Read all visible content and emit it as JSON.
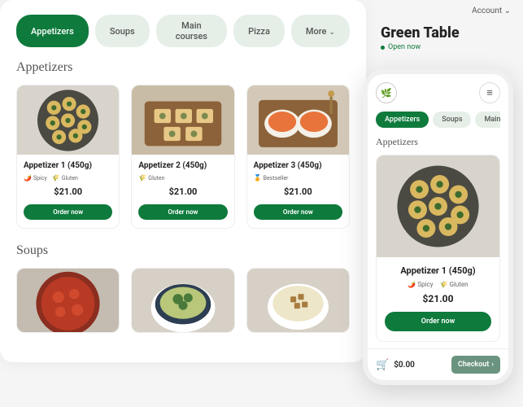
{
  "desktop": {
    "tabs": [
      "Appetizers",
      "Soups",
      "Main courses",
      "Pizza",
      "More"
    ],
    "active_tab_index": 0,
    "sections": {
      "appetizers": {
        "title": "Appetizers",
        "items": [
          {
            "name": "Appetizer 1 (450g)",
            "tags": [
              {
                "icon": "🌶️",
                "label": "Spicy"
              },
              {
                "icon": "🌾",
                "label": "Gluten"
              }
            ],
            "price": "$21.00",
            "cta": "Order now"
          },
          {
            "name": "Appetizer 2 (450g)",
            "tags": [
              {
                "icon": "🌾",
                "label": "Gluten"
              }
            ],
            "price": "$21.00",
            "cta": "Order now"
          },
          {
            "name": "Appetizer 3 (450g)",
            "tags": [
              {
                "icon": "🏅",
                "label": "Bestseller"
              }
            ],
            "price": "$21.00",
            "cta": "Order now"
          }
        ]
      },
      "soups": {
        "title": "Soups"
      }
    }
  },
  "header": {
    "account_label": "Account",
    "restaurant_name": "Green Table",
    "status": "Open now"
  },
  "phone": {
    "tabs": [
      "Appetizers",
      "Soups",
      "Main cou"
    ],
    "active_tab_index": 0,
    "section_title": "Appetizers",
    "card": {
      "name": "Appetizer 1 (450g)",
      "tags": [
        {
          "icon": "🌶️",
          "label": "Spicy"
        },
        {
          "icon": "🌾",
          "label": "Gluten"
        }
      ],
      "price": "$21.00",
      "cta": "Order now"
    },
    "footer": {
      "cart_total": "$0.00",
      "checkout": "Checkout"
    }
  },
  "images": {
    "pinwheels": "data:image/svg+xml;utf8,<svg xmlns='http://www.w3.org/2000/svg' width='160' height='120'><rect width='160' height='120' fill='%23d8d4cc'/><circle cx='80' cy='60' r='48' fill='%234a4a42'/><g fill='%23d9b860'><circle cx='58' cy='40' r='11'/><circle cx='82' cy='34' r='11'/><circle cx='104' cy='46' r='11'/><circle cx='56' cy='64' r='11'/><circle cx='80' cy='60' r='11'/><circle cx='106' cy='70' r='11'/><circle cx='66' cy='86' r='11'/><circle cx='92' cy='84' r='11'/></g><g fill='%233d6b2e'><circle cx='58' cy='40' r='4'/><circle cx='82' cy='34' r='4'/><circle cx='104' cy='46' r='4'/><circle cx='56' cy='64' r='4'/><circle cx='80' cy='60' r='4'/><circle cx='106' cy='70' r='4'/><circle cx='66' cy='86' r='4'/><circle cx='92' cy='84' r='4'/></g></svg>",
    "tarts": "data:image/svg+xml;utf8,<svg xmlns='http://www.w3.org/2000/svg' width='160' height='120'><rect width='160' height='120' fill='%23c9bca6'/><rect x='20' y='30' width='120' height='70' rx='6' fill='%238b6239'/><g><rect x='35' y='42' width='26' height='22' rx='3' fill='%23e8c887'/><rect x='68' y='42' width='26' height='22' rx='3' fill='%23e8c887'/><rect x='101' y='42' width='26' height='22' rx='3' fill='%23e8c887'/><rect x='50' y='70' width='26' height='22' rx='3' fill='%23e8c887'/><rect x='84' y='70' width='26' height='22' rx='3' fill='%23e8c887'/></g><g fill='%237a8a4e'><circle cx='48' cy='53' r='5'/><circle cx='81' cy='53' r='5'/><circle cx='114' cy='53' r='5'/><circle cx='63' cy='81' r='5'/><circle cx='97' cy='81' r='5'/></g></svg>",
    "salmon": "data:image/svg+xml;utf8,<svg xmlns='http://www.w3.org/2000/svg' width='160' height='120'><rect width='160' height='120' fill='%23d4c9b8'/><rect x='18' y='28' width='124' height='74' rx='6' fill='%238b6239'/><ellipse cx='55' cy='65' rx='28' ry='22' fill='%23f5f0e8'/><ellipse cx='105' cy='65' rx='28' ry='22' fill='%23f5f0e8'/><ellipse cx='55' cy='62' rx='22' ry='16' fill='%23e8743b'/><ellipse cx='105' cy='62' rx='22' ry='16' fill='%23e8743b'/><rect x='130' y='20' width='4' height='30' fill='%239b7a42'/><circle cx='132' cy='18' r='5' fill='%23c49a4e'/></svg>",
    "tomato_soup": "data:image/svg+xml;utf8,<svg xmlns='http://www.w3.org/2000/svg' width='160' height='120'><rect width='160' height='120' fill='%23c4bcb0'/><circle cx='80' cy='65' r='50' fill='%238b2e1f'/><circle cx='80' cy='65' r='42' fill='%23b83a24'/><g fill='%23d14a2e'><circle cx='65' cy='55' r='9'/><circle cx='90' cy='50' r='8'/><circle cx='95' cy='75' r='9'/><circle cx='68' cy='78' r='8'/></g></svg>",
    "broccoli_soup": "data:image/svg+xml;utf8,<svg xmlns='http://www.w3.org/2000/svg' width='160' height='120'><rect width='160' height='120' fill='%23d6d0c6'/><ellipse cx='80' cy='72' rx='50' ry='38' fill='%23fff'/><ellipse cx='80' cy='66' rx='42' ry='30' fill='%232d3e52' stroke='%232d3e52' stroke-width='3'/><ellipse cx='80' cy='64' rx='36' ry='25' fill='%23b8c77a'/><g fill='%234a7a3a'><circle cx='72' cy='58' r='8'/><circle cx='88' cy='56' r='7'/><circle cx='80' cy='68' r='7'/></g></svg>",
    "crouton_soup": "data:image/svg+xml;utf8,<svg xmlns='http://www.w3.org/2000/svg' width='160' height='120'><rect width='160' height='120' fill='%23d6d0c6'/><ellipse cx='80' cy='70' rx='48' ry='36' fill='%23fff'/><ellipse cx='80' cy='65' rx='40' ry='28' fill='%23ede6c8'/><g fill='%23a87c3e'><rect x='68' y='54' width='9' height='9' rx='1'/><rect x='80' y='50' width='9' height='9' rx='1'/><rect x='74' y='64' width='9' height='9' rx='1'/><rect x='86' y='62' width='9' height='9' rx='1'/></g></svg>"
  }
}
